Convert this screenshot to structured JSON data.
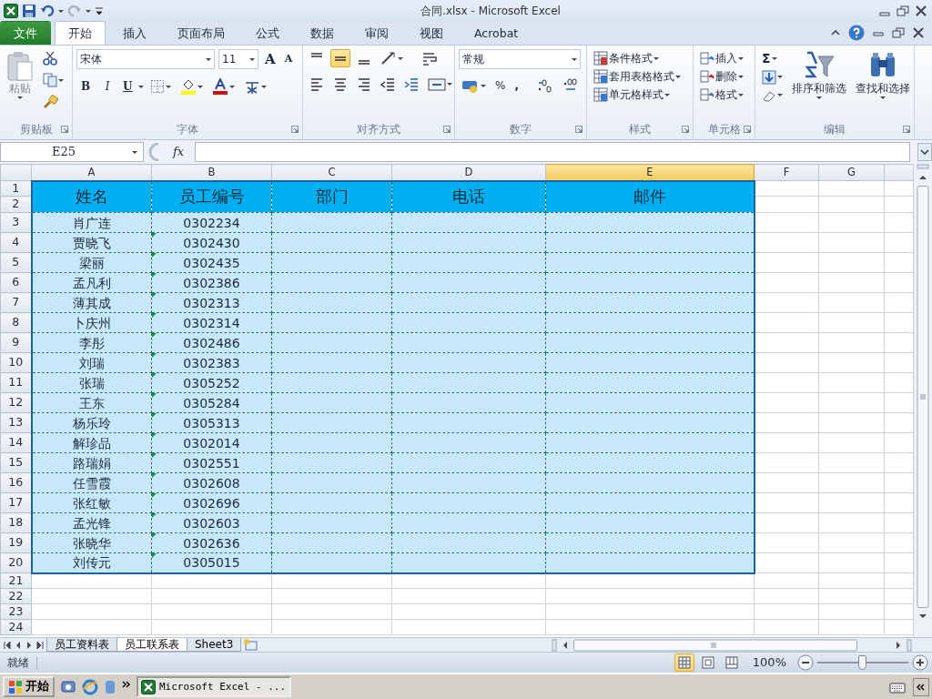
{
  "window": {
    "title": "合同.xlsx  -  Microsoft Excel"
  },
  "ribbon_tabs": [
    {
      "label": "文件",
      "kind": "file",
      "selected": false
    },
    {
      "label": "开始",
      "kind": "tab",
      "selected": true
    },
    {
      "label": "插入",
      "kind": "tab",
      "selected": false
    },
    {
      "label": "页面布局",
      "kind": "tab",
      "selected": false
    },
    {
      "label": "公式",
      "kind": "tab",
      "selected": false
    },
    {
      "label": "数据",
      "kind": "tab",
      "selected": false
    },
    {
      "label": "审阅",
      "kind": "tab",
      "selected": false
    },
    {
      "label": "视图",
      "kind": "tab",
      "selected": false
    },
    {
      "label": "Acrobat",
      "kind": "tab",
      "selected": false
    }
  ],
  "clipboard": {
    "paste": "粘贴",
    "group": "剪贴板"
  },
  "font": {
    "font_name": "宋体",
    "font_size": "11",
    "grow": "A",
    "shrink": "A",
    "bold": "B",
    "italic": "I",
    "underline": "U",
    "group": "字体"
  },
  "alignment": {
    "vertical": [
      {
        "selected": false
      },
      {
        "selected": true
      },
      {
        "selected": false
      }
    ],
    "group": "对齐方式"
  },
  "number": {
    "format": "常规",
    "percent": "%",
    "comma": ",",
    "group": "数字"
  },
  "styles": {
    "items": [
      "条件格式",
      "套用表格格式",
      "单元格样式"
    ],
    "group": "样式"
  },
  "cells": {
    "items": [
      "插入",
      "删除",
      "格式"
    ],
    "group": "单元格"
  },
  "editing": {
    "sum": "Σ",
    "sort": "排序和筛选",
    "find": "查找和选择",
    "group": "编辑"
  },
  "formula_bar": {
    "name_box": "E25",
    "function_label": "fx"
  },
  "grid": {
    "columns": [
      {
        "label": "A",
        "selected": false
      },
      {
        "label": "B",
        "selected": false
      },
      {
        "label": "C",
        "selected": false
      },
      {
        "label": "D",
        "selected": false
      },
      {
        "label": "E",
        "selected": true
      },
      {
        "label": "F",
        "selected": false
      },
      {
        "label": "G",
        "selected": false
      }
    ],
    "row_numbers": [
      "1",
      "2",
      "3",
      "4",
      "5",
      "6",
      "7",
      "8",
      "9",
      "10",
      "11",
      "12",
      "13",
      "14",
      "15",
      "16",
      "17",
      "18",
      "19",
      "20",
      "21",
      "22",
      "23",
      "24"
    ],
    "headers": [
      "姓名",
      "员工编号",
      "部门",
      "电话",
      "邮件"
    ],
    "rows": [
      {
        "name": "肖广连",
        "id": "0302234",
        "flag": false
      },
      {
        "name": "贾晓飞",
        "id": "0302430",
        "flag": true
      },
      {
        "name": "梁丽",
        "id": "0302435",
        "flag": true
      },
      {
        "name": "孟凡利",
        "id": "0302386",
        "flag": true
      },
      {
        "name": "薄其成",
        "id": "0302313",
        "flag": true
      },
      {
        "name": "卜庆州",
        "id": "0302314",
        "flag": true
      },
      {
        "name": "李彤",
        "id": "0302486",
        "flag": true
      },
      {
        "name": "刘瑞",
        "id": "0302383",
        "flag": true
      },
      {
        "name": "张瑞",
        "id": "0305252",
        "flag": true
      },
      {
        "name": "王东",
        "id": "0305284",
        "flag": true
      },
      {
        "name": "杨乐玲",
        "id": "0305313",
        "flag": true
      },
      {
        "name": "解珍品",
        "id": "0302014",
        "flag": true
      },
      {
        "name": "路瑞娟",
        "id": "0302551",
        "flag": true
      },
      {
        "name": "任雪霞",
        "id": "0302608",
        "flag": true
      },
      {
        "name": "张红敏",
        "id": "0302696",
        "flag": true
      },
      {
        "name": "孟光锋",
        "id": "0302603",
        "flag": true
      },
      {
        "name": "张晓华",
        "id": "0302636",
        "flag": true
      },
      {
        "name": "刘传元",
        "id": "0305015",
        "flag": true
      }
    ]
  },
  "sheet_tabs": [
    {
      "label": "员工资料表",
      "selected": false
    },
    {
      "label": "员工联系表",
      "selected": true
    },
    {
      "label": "Sheet3",
      "selected": false
    }
  ],
  "status_bar": {
    "status": "就绪",
    "views": [
      {
        "selected": true
      },
      {
        "selected": false
      },
      {
        "selected": false
      }
    ],
    "zoom": "100%",
    "zoom_slider": {
      "level": 0.5
    }
  },
  "taskbar": {
    "start": "开始",
    "window": "Microsoft Excel - ..."
  }
}
